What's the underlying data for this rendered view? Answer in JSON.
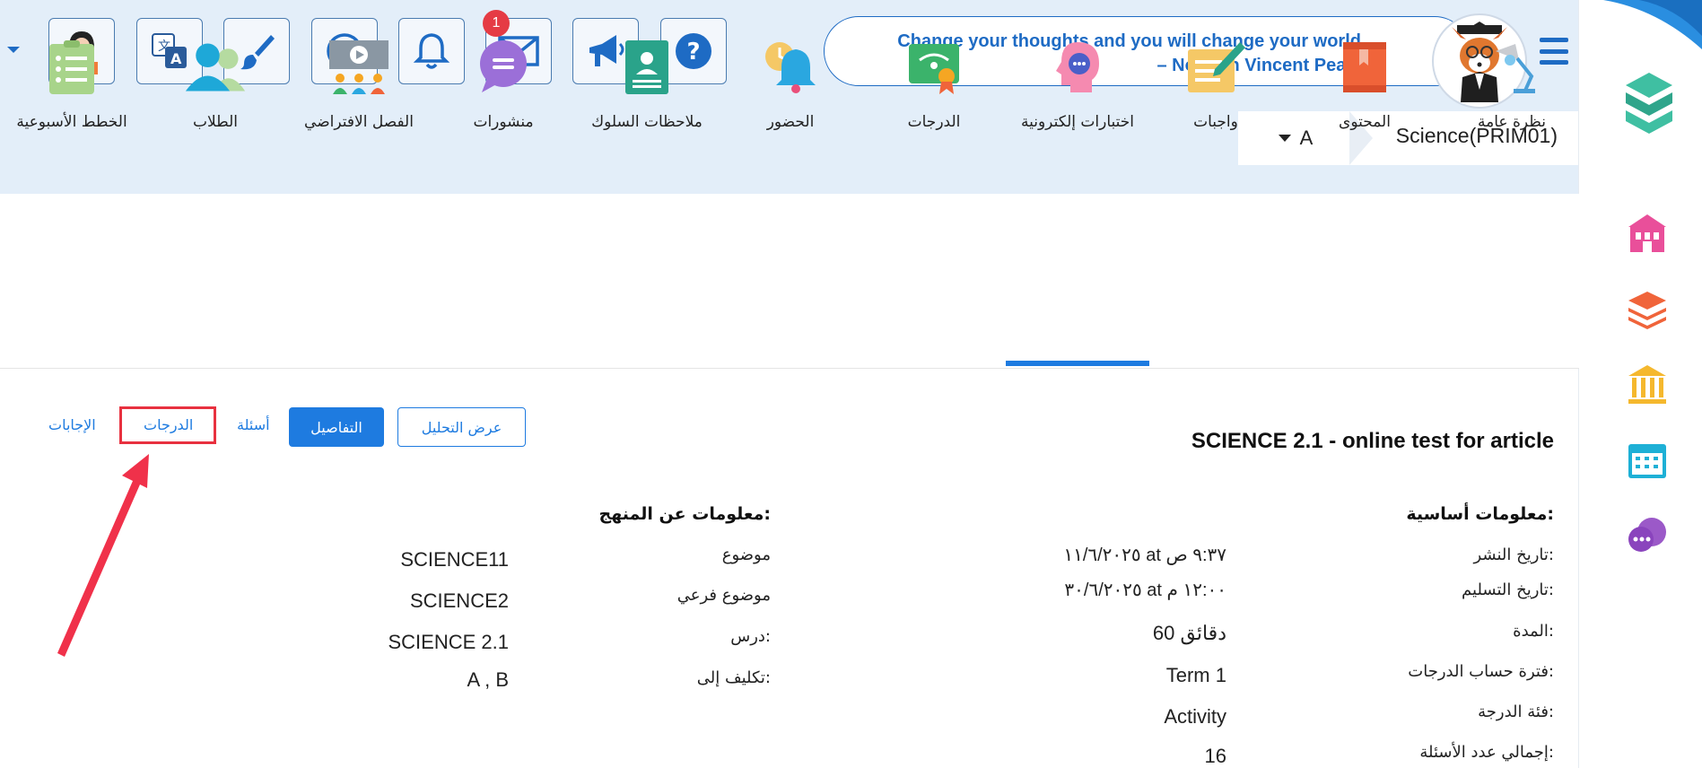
{
  "header": {
    "quote": "Change your thoughts and you will change your world – Norman Vincent Peale",
    "notification_count": "1",
    "toolbar_icons": [
      "teacher-icon",
      "translate-icon",
      "brush-icon",
      "smiley-icon",
      "bell-icon",
      "mail-icon",
      "megaphone-icon",
      "help-icon"
    ]
  },
  "course": {
    "name": "Science(PRIM01)",
    "class": "A"
  },
  "nav": {
    "items": [
      {
        "label": "نظرة عامة",
        "icon": "overview-lamp-icon"
      },
      {
        "label": "المحتوى",
        "icon": "book-icon"
      },
      {
        "label": "واجبات",
        "icon": "assignment-pen-icon"
      },
      {
        "label": "اختبارات إلكترونية",
        "icon": "online-test-head-icon"
      },
      {
        "label": "الدرجات",
        "icon": "grades-certificate-icon"
      },
      {
        "label": "الحضور",
        "icon": "attendance-bell-icon"
      },
      {
        "label": "ملاحظات السلوك",
        "icon": "behavior-notes-icon"
      },
      {
        "label": "منشورات",
        "icon": "posts-chat-icon"
      },
      {
        "label": "الفصل الافتراضي",
        "icon": "virtual-class-icon"
      },
      {
        "label": "الطلاب",
        "icon": "students-icon"
      },
      {
        "label": "الخطط الأسبوعية",
        "icon": "weekly-plan-icon"
      }
    ],
    "active": "اختبارات إلكترونية"
  },
  "actions": {
    "analysis": "عرض التحليل",
    "details": "التفاصيل",
    "questions": "أسئلة",
    "grades": "الدرجات",
    "answers": "الإجابات"
  },
  "test": {
    "title": "SCIENCE 2.1 - online test for article",
    "basic_heading": "معلومات أساسية:",
    "curriculum_heading": "معلومات عن المنهج:",
    "basic": [
      {
        "label": "تاريخ النشر:",
        "value": "١١/٦/٢٠٢٥ at ٩:٣٧ ص"
      },
      {
        "label": "تاريخ التسليم:",
        "value": "٣٠/٦/٢٠٢٥ at ١٢:٠٠ م"
      },
      {
        "label": "المدة:",
        "value": "60 دقائق"
      },
      {
        "label": "فترة حساب الدرجات:",
        "value": "Term 1"
      },
      {
        "label": "فئة الدرجة:",
        "value": "Activity"
      },
      {
        "label": "إجمالي عدد الأسئلة:",
        "value": "16"
      }
    ],
    "curriculum": [
      {
        "label": "موضوع",
        "value": "SCIENCE11"
      },
      {
        "label": "موضوع فرعي",
        "value": "SCIENCE2"
      },
      {
        "label": "درس:",
        "value": "SCIENCE 2.1"
      },
      {
        "label": "تكليف إلى:",
        "value": "A , B"
      }
    ]
  },
  "right_rail": {
    "icons": [
      "app-logo-icon",
      "school-icon",
      "layers-icon",
      "institution-icon",
      "calendar-icon",
      "chat-support-icon"
    ]
  },
  "colors": {
    "accent": "#1e7be0",
    "header_bg": "#e3eef9",
    "highlight": "#e8313f"
  }
}
